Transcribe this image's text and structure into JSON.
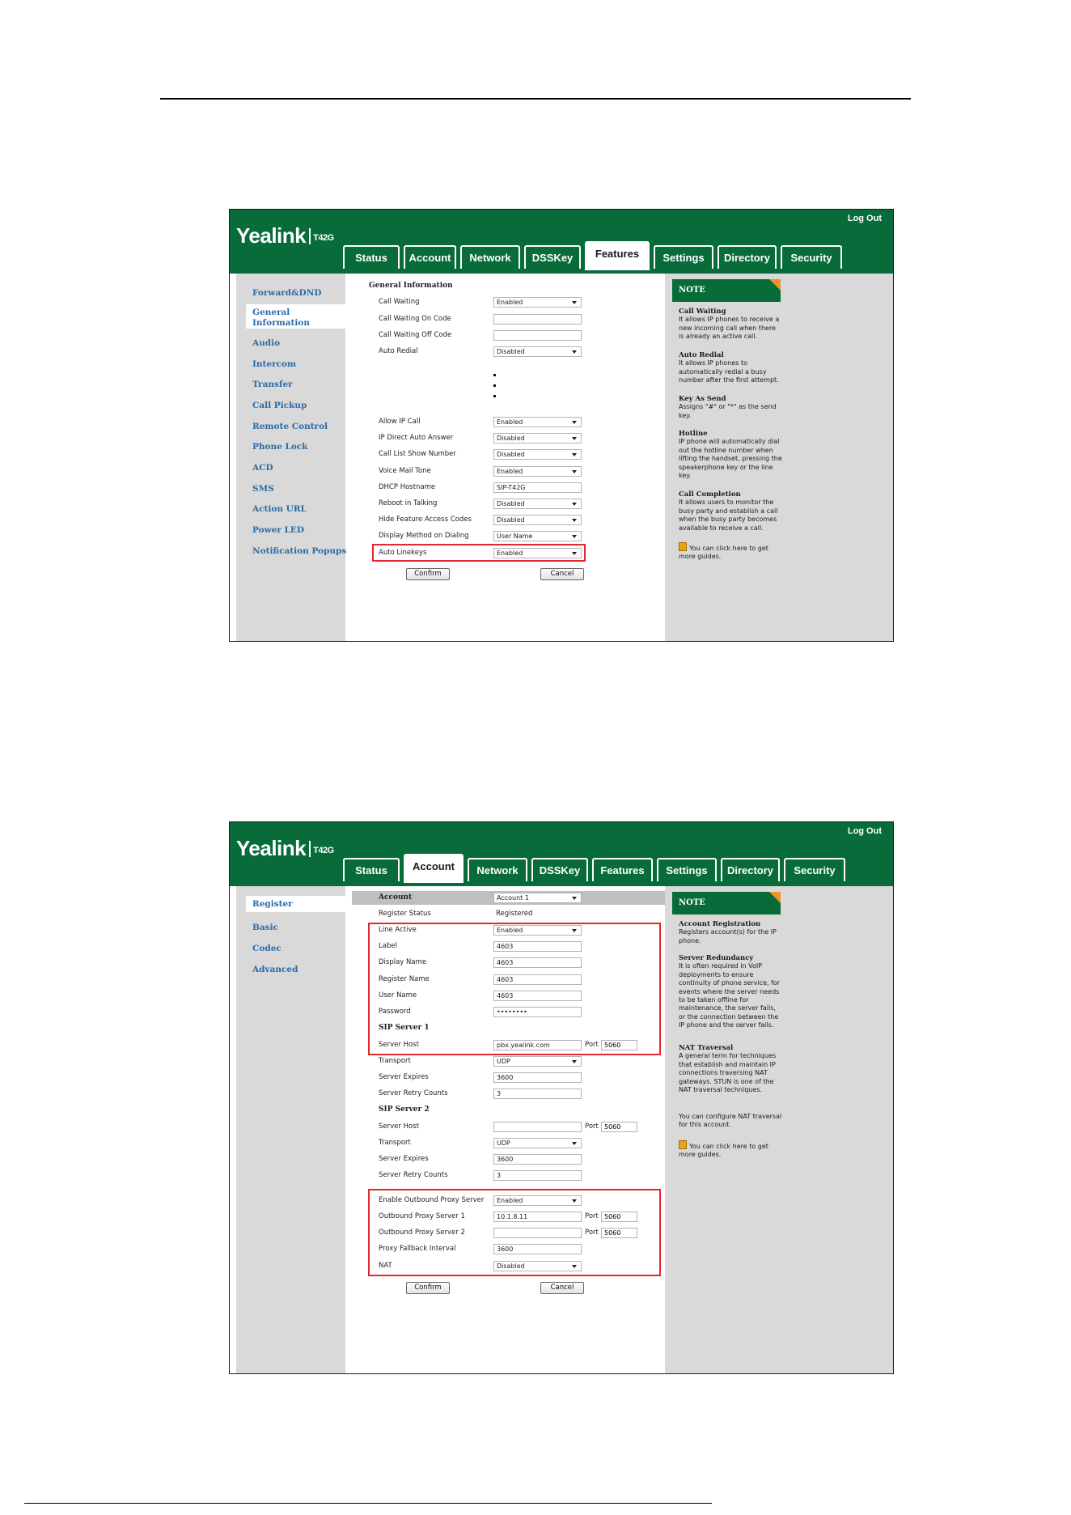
{
  "screenshot1": {
    "logo": "Yealink",
    "model": "T42G",
    "logout": "Log Out",
    "tabs": [
      "Status",
      "Account",
      "Network",
      "DSSKey",
      "Features",
      "Settings",
      "Directory",
      "Security"
    ],
    "active_tab": "Features",
    "sidebar": [
      "Forward&DND",
      "General Information",
      "Audio",
      "Intercom",
      "Transfer",
      "Call Pickup",
      "Remote Control",
      "Phone Lock",
      "ACD",
      "SMS",
      "Action URL",
      "Power LED",
      "Notification Popups"
    ],
    "active_sidebar": "General Information",
    "section_title": "General Information",
    "rows_top": [
      {
        "label": "Call Waiting",
        "value": "Enabled",
        "type": "select"
      },
      {
        "label": "Call Waiting On Code",
        "value": "",
        "type": "text"
      },
      {
        "label": "Call Waiting Off Code",
        "value": "",
        "type": "text"
      },
      {
        "label": "Auto Redial",
        "value": "Disabled",
        "type": "select"
      }
    ],
    "rows_bottom": [
      {
        "label": "Allow IP Call",
        "value": "Enabled",
        "type": "select"
      },
      {
        "label": "IP Direct Auto Answer",
        "value": "Disabled",
        "type": "select"
      },
      {
        "label": "Call List Show Number",
        "value": "Disabled",
        "type": "select"
      },
      {
        "label": "Voice Mail Tone",
        "value": "Enabled",
        "type": "select"
      },
      {
        "label": "DHCP Hostname",
        "value": "SIP-T42G",
        "type": "text"
      },
      {
        "label": "Reboot in Talking",
        "value": "Disabled",
        "type": "select"
      },
      {
        "label": "Hide Feature Access Codes",
        "value": "Disabled",
        "type": "select"
      },
      {
        "label": "Display Method on Dialing",
        "value": "User Name",
        "type": "select"
      },
      {
        "label": "Auto Linekeys",
        "value": "Enabled",
        "type": "select"
      }
    ],
    "confirm": "Confirm",
    "cancel": "Cancel",
    "note_title": "NOTE",
    "notes": [
      {
        "title": "Call Waiting",
        "text": "It allows IP phones to receive a new incoming call when there is already an active call."
      },
      {
        "title": "Auto Redial",
        "text": "It allows IP phones to automatically redial a busy number after the first attempt."
      },
      {
        "title": "Key As Send",
        "text": "Assigns \"#\" or \"*\" as the send key."
      },
      {
        "title": "Hotline",
        "text": "IP phone will automatically dial out the hotline number when lifting the handset, pressing the speakerphone key or the line key."
      },
      {
        "title": "Call Completion",
        "text": "It allows users to monitor the busy party and establish a call when the busy party becomes available to receive a call."
      }
    ],
    "guide": "You can click here to get more guides."
  },
  "screenshot2": {
    "logo": "Yealink",
    "model": "T42G",
    "logout": "Log Out",
    "tabs": [
      "Status",
      "Account",
      "Network",
      "DSSKey",
      "Features",
      "Settings",
      "Directory",
      "Security"
    ],
    "active_tab": "Account",
    "sidebar": [
      "Register",
      "Basic",
      "Codec",
      "Advanced"
    ],
    "active_sidebar": "Register",
    "account_label": "Account",
    "account_value": "Account 1",
    "register_status_label": "Register Status",
    "register_status_value": "Registered",
    "rows_a": [
      {
        "label": "Line Active",
        "value": "Enabled",
        "type": "select"
      },
      {
        "label": "Label",
        "value": "4603",
        "type": "text"
      },
      {
        "label": "Display Name",
        "value": "4603",
        "type": "text"
      },
      {
        "label": "Register Name",
        "value": "4603",
        "type": "text"
      },
      {
        "label": "User Name",
        "value": "4603",
        "type": "text"
      },
      {
        "label": "Password",
        "value": "••••••••",
        "type": "text"
      }
    ],
    "sip_server_1": "SIP Server 1",
    "sip_server_2": "SIP Server 2",
    "server1": {
      "host_label": "Server Host",
      "host": "pbx.yealink.com",
      "port_label": "Port",
      "port": "5060",
      "transport_label": "Transport",
      "transport": "UDP",
      "expires_label": "Server Expires",
      "expires": "3600",
      "retry_label": "Server Retry Counts",
      "retry": "3"
    },
    "server2": {
      "host_label": "Server Host",
      "host": "",
      "port_label": "Port",
      "port": "5060",
      "transport_label": "Transport",
      "transport": "UDP",
      "expires_label": "Server Expires",
      "expires": "3600",
      "retry_label": "Server Retry Counts",
      "retry": "3"
    },
    "proxy": {
      "enable_label": "Enable Outbound Proxy Server",
      "enable": "Enabled",
      "p1_label": "Outbound Proxy Server 1",
      "p1": "10.1.8.11",
      "p1_port": "5060",
      "p2_label": "Outbound Proxy Server 2",
      "p2": "",
      "p2_port": "5060",
      "fallback_label": "Proxy Fallback Interval",
      "fallback": "3600",
      "nat_label": "NAT",
      "nat": "Disabled",
      "port_label": "Port"
    },
    "confirm": "Confirm",
    "cancel": "Cancel",
    "note_title": "NOTE",
    "notes": [
      {
        "title": "Account Registration",
        "text": "Registers account(s) for the IP phone."
      },
      {
        "title": "Server Redundancy",
        "text": "It is often required in VoIP deployments to ensure continuity of phone service, for events where the server needs to be taken offline for maintenance, the server fails, or the connection between the IP phone and the server fails."
      },
      {
        "title": "NAT Traversal",
        "text": "A general term for techniques that establish and maintain IP connections traversing NAT gateways. STUN is one of the NAT traversal techniques."
      }
    ],
    "nat_config_note": "You can configure NAT traversal for this account.",
    "guide": "You can click here to get more guides."
  },
  "colors": {
    "brand_green": "#076c3a",
    "highlight_red": "#e5262c",
    "link_blue": "#2b6ba8",
    "panel_gray": "#d9d9d9",
    "corner_orange": "#f0932b"
  }
}
